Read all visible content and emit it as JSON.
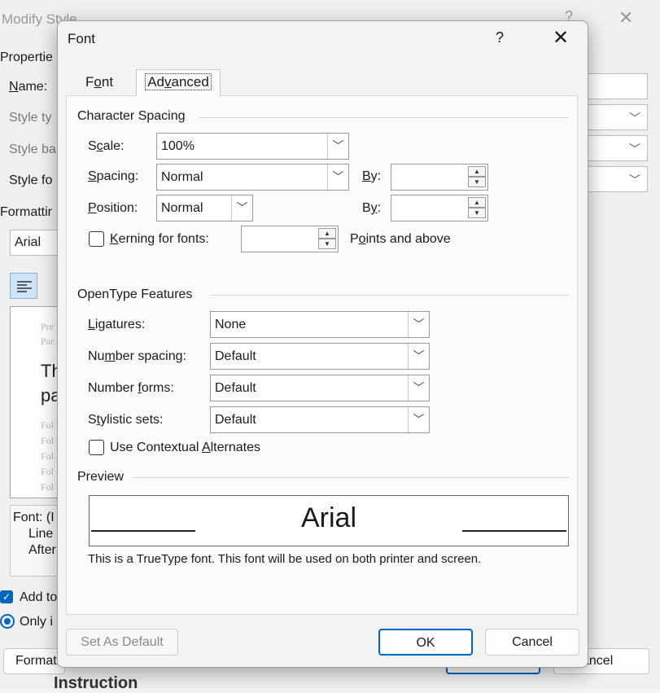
{
  "background_dialog": {
    "title": "Modify Style",
    "help_label": "?",
    "close_glyph": "✕",
    "properties_label": "Propertie",
    "name_label": "Name:",
    "style_type_label": "Style ty",
    "style_based_label": "Style ba",
    "style_following_label": "Style fo",
    "formatting_label": "Formattir",
    "font_value": "Arial",
    "preview_snippet_1": "Pre",
    "preview_snippet_2": "Par",
    "preview_big_1": "Th",
    "preview_big_2": "pa",
    "preview_following": [
      "Fol",
      "Fol",
      "Fol",
      "Fol",
      "Fol"
    ],
    "desc_line_1": "Font: (I",
    "desc_line_2": "Line",
    "desc_line_3": "After",
    "add_to_label": "Add to",
    "only_label": "Only i",
    "format_button": "Format",
    "cancel_button": "ancel",
    "bottom_fragment": "Instruction"
  },
  "dialog": {
    "title": "Font",
    "help_label": "?",
    "close_glyph": "✕",
    "accent_color": "#0067c0"
  },
  "tabs": {
    "font": "Font",
    "advanced": "Advanced",
    "active": "Advanced"
  },
  "character_spacing": {
    "section_title": "Character Spacing",
    "scale_label": "Scale:",
    "scale_value": "100%",
    "spacing_label": "Spacing:",
    "spacing_value": "Normal",
    "spacing_by_label": "By:",
    "spacing_by_value": "",
    "position_label": "Position:",
    "position_value": "Normal",
    "position_by_label": "By:",
    "position_by_value": "",
    "kerning_label": "Kerning for fonts:",
    "kerning_checked": false,
    "kerning_value": "",
    "kerning_suffix": "Points and above"
  },
  "opentype": {
    "section_title": "OpenType Features",
    "ligatures_label": "Ligatures:",
    "ligatures_value": "None",
    "number_spacing_label": "Number spacing:",
    "number_spacing_value": "Default",
    "number_forms_label": "Number forms:",
    "number_forms_value": "Default",
    "stylistic_sets_label": "Stylistic sets:",
    "stylistic_sets_value": "Default",
    "contextual_label": "Use Contextual Alternates",
    "contextual_checked": false
  },
  "preview": {
    "section_title": "Preview",
    "sample_text": "Arial",
    "description": "This is a TrueType font. This font will be used on both printer and screen."
  },
  "buttons": {
    "set_default": "Set As Default",
    "ok": "OK",
    "cancel": "Cancel"
  },
  "icons": {
    "dropdown": "chevron-down-icon",
    "spin_up": "spin-up-icon",
    "spin_down": "spin-down-icon",
    "close": "close-icon",
    "help": "help-icon",
    "align_left": "align-left-icon"
  }
}
